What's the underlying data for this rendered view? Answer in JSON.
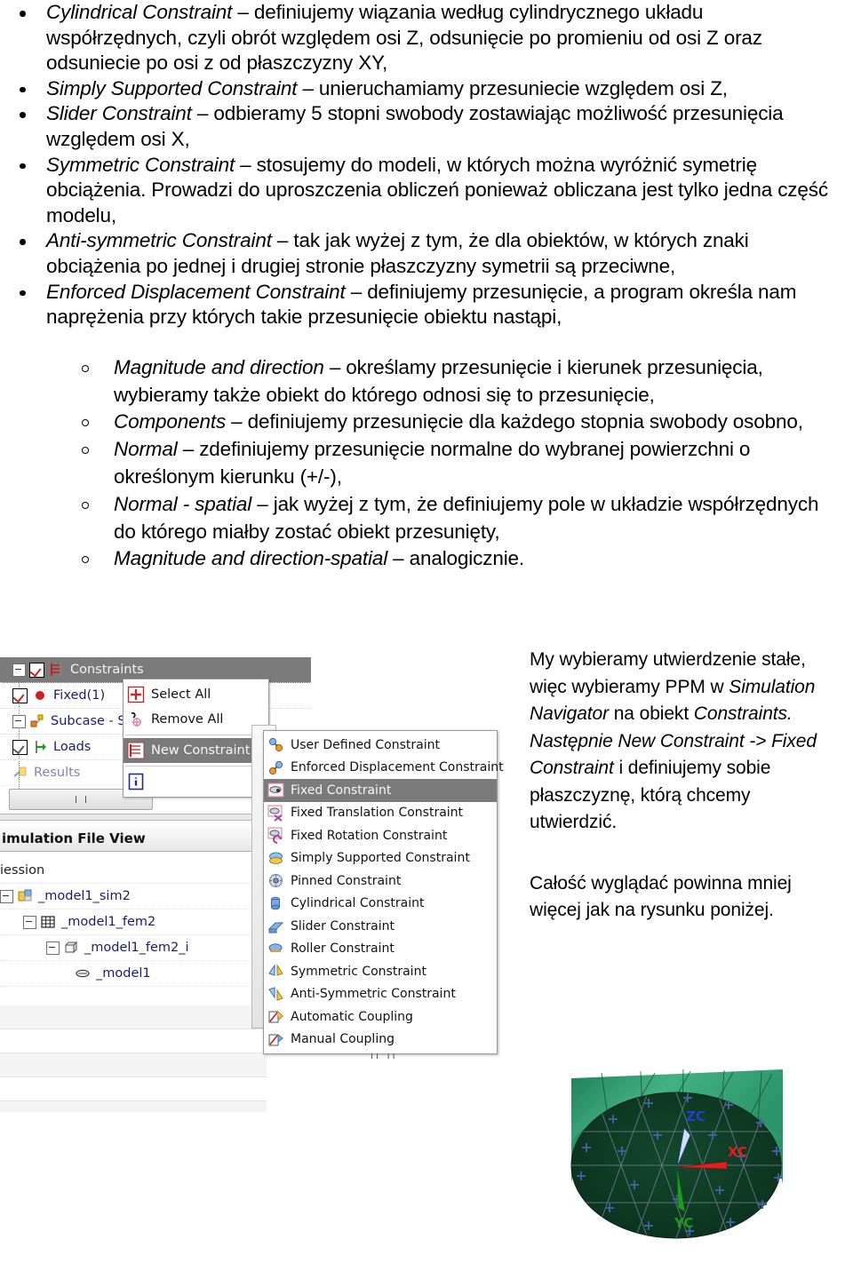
{
  "document": {
    "bullets": [
      {
        "term": "Cylindrical Constraint",
        "text": " – definiujemy wiązania według cylindrycznego układu współrzędnych, czyli obrót względem osi Z, odsunięcie po promieniu od osi Z oraz odsuniecie po osi z od płaszczyzny XY,"
      },
      {
        "term": "Simply Supported Constraint",
        "text": " – unieruchamiamy przesuniecie względem osi Z,"
      },
      {
        "term": "Slider Constraint",
        "text": " – odbieramy 5 stopni swobody zostawiając możliwość przesunięcia względem osi X,"
      },
      {
        "term": "Symmetric Constraint",
        "text": " – stosujemy do modeli, w których można wyróżnić symetrię obciążenia. Prowadzi do uproszczenia obliczeń ponieważ obliczana jest tylko jedna część modelu,"
      },
      {
        "term": "Anti-symmetric Constraint",
        "text": " – tak jak wyżej z tym, że dla obiektów, w których znaki obciążenia po jednej i drugiej stronie płaszczyzny symetrii są przeciwne,"
      },
      {
        "term": "Enforced Displacement Constraint",
        "text": " – definiujemy przesunięcie, a program określa nam naprężenia przy których takie przesunięcie obiektu nastąpi,"
      }
    ],
    "subbullets": [
      {
        "term": "Magnitude and direction",
        "text": " – określamy przesunięcie i kierunek przesunięcia, wybieramy także obiekt do którego odnosi się to przesunięcie,"
      },
      {
        "term": "Components",
        "text": " – definiujemy przesunięcie dla każdego stopnia swobody osobno,"
      },
      {
        "term": "Normal",
        "text": " – zdefiniujemy przesunięcie normalne do wybranej powierzchni o określonym kierunku (+/-),"
      },
      {
        "term": "Normal - spatial",
        "text": " – jak wyżej z tym, że definiujemy pole w układzie współrzędnych do którego miałby zostać obiekt przesunięty,"
      },
      {
        "term": "Magnitude and direction-spatial",
        "text": " – analogicznie."
      }
    ]
  },
  "right_column": {
    "paragraph1_part1": "My wybieramy utwierdzenie stałe, więc wybieramy PPM w ",
    "paragraph1_italic1": "Simulation Navigator",
    "paragraph1_part2": " na obiekt ",
    "paragraph1_italic2": "Constraints. Następnie New Constraint -> Fixed Constraint",
    "paragraph1_part3": " i definiujemy sobie płaszczyznę, którą chcemy utwierdzić.",
    "paragraph2": "Całość wyglądać powinna mniej więcej jak na rysunku poniżej."
  },
  "screenshot": {
    "navigator_tree": [
      {
        "label": "Constraints",
        "selected": true,
        "checkbox": "red",
        "indent": 0,
        "expander": true
      },
      {
        "label": "Fixed(1)",
        "selected": false,
        "checkbox": "red",
        "indent": 1,
        "expander": false
      },
      {
        "label": "Subcase - Static .",
        "selected": false,
        "checkbox": "none",
        "indent": 0,
        "expander": true
      },
      {
        "label": "Loads",
        "selected": false,
        "checkbox": "grey",
        "indent": 1,
        "expander": false
      },
      {
        "label": "Results",
        "selected": false,
        "checkbox": "none",
        "indent": 1,
        "expander": false
      }
    ],
    "file_view": {
      "header": "imulation File View",
      "rows": [
        {
          "label": "iession",
          "indent": 0
        },
        {
          "label": "_model1_sim2",
          "indent": 0
        },
        {
          "label": "_model1_fem2",
          "indent": 1
        },
        {
          "label": "_model1_fem2_i",
          "indent": 2
        },
        {
          "label": "_model1",
          "indent": 3
        }
      ]
    },
    "context_menu": [
      {
        "label": "Select All",
        "icon": "select-all-icon",
        "highlighted": false,
        "submenu": false
      },
      {
        "label": "Remove All",
        "icon": "remove-all-icon",
        "highlighted": false,
        "submenu": false
      },
      {
        "separator": true
      },
      {
        "label": "New Constraint",
        "icon": "new-constraint-icon",
        "highlighted": true,
        "submenu": true
      },
      {
        "separator": true
      },
      {
        "label": "Information",
        "icon": "information-icon",
        "highlighted": false,
        "submenu": false
      }
    ],
    "submenu": [
      {
        "label": "User Defined Constraint",
        "highlighted": false
      },
      {
        "label": "Enforced Displacement Constraint",
        "highlighted": false
      },
      {
        "label": "Fixed Constraint",
        "highlighted": true
      },
      {
        "label": "Fixed Translation Constraint",
        "highlighted": false
      },
      {
        "label": "Fixed Rotation Constraint",
        "highlighted": false
      },
      {
        "label": "Simply Supported Constraint",
        "highlighted": false
      },
      {
        "label": "Pinned Constraint",
        "highlighted": false
      },
      {
        "label": "Cylindrical Constraint",
        "highlighted": false
      },
      {
        "label": "Slider Constraint",
        "highlighted": false
      },
      {
        "label": "Roller Constraint",
        "highlighted": false
      },
      {
        "label": "Symmetric Constraint",
        "highlighted": false
      },
      {
        "label": "Anti-Symmetric Constraint",
        "highlighted": false
      },
      {
        "label": "Automatic Coupling",
        "highlighted": false
      },
      {
        "label": "Manual Coupling",
        "highlighted": false
      }
    ]
  },
  "model_image": {
    "axis_labels": {
      "x": "XC",
      "y": "YC",
      "z": "ZC"
    },
    "colors": {
      "x": "#e02020",
      "y": "#1f9b1f",
      "z": "#2040d0",
      "surface": "#2e9e6b",
      "face": "#0e3a24"
    }
  }
}
